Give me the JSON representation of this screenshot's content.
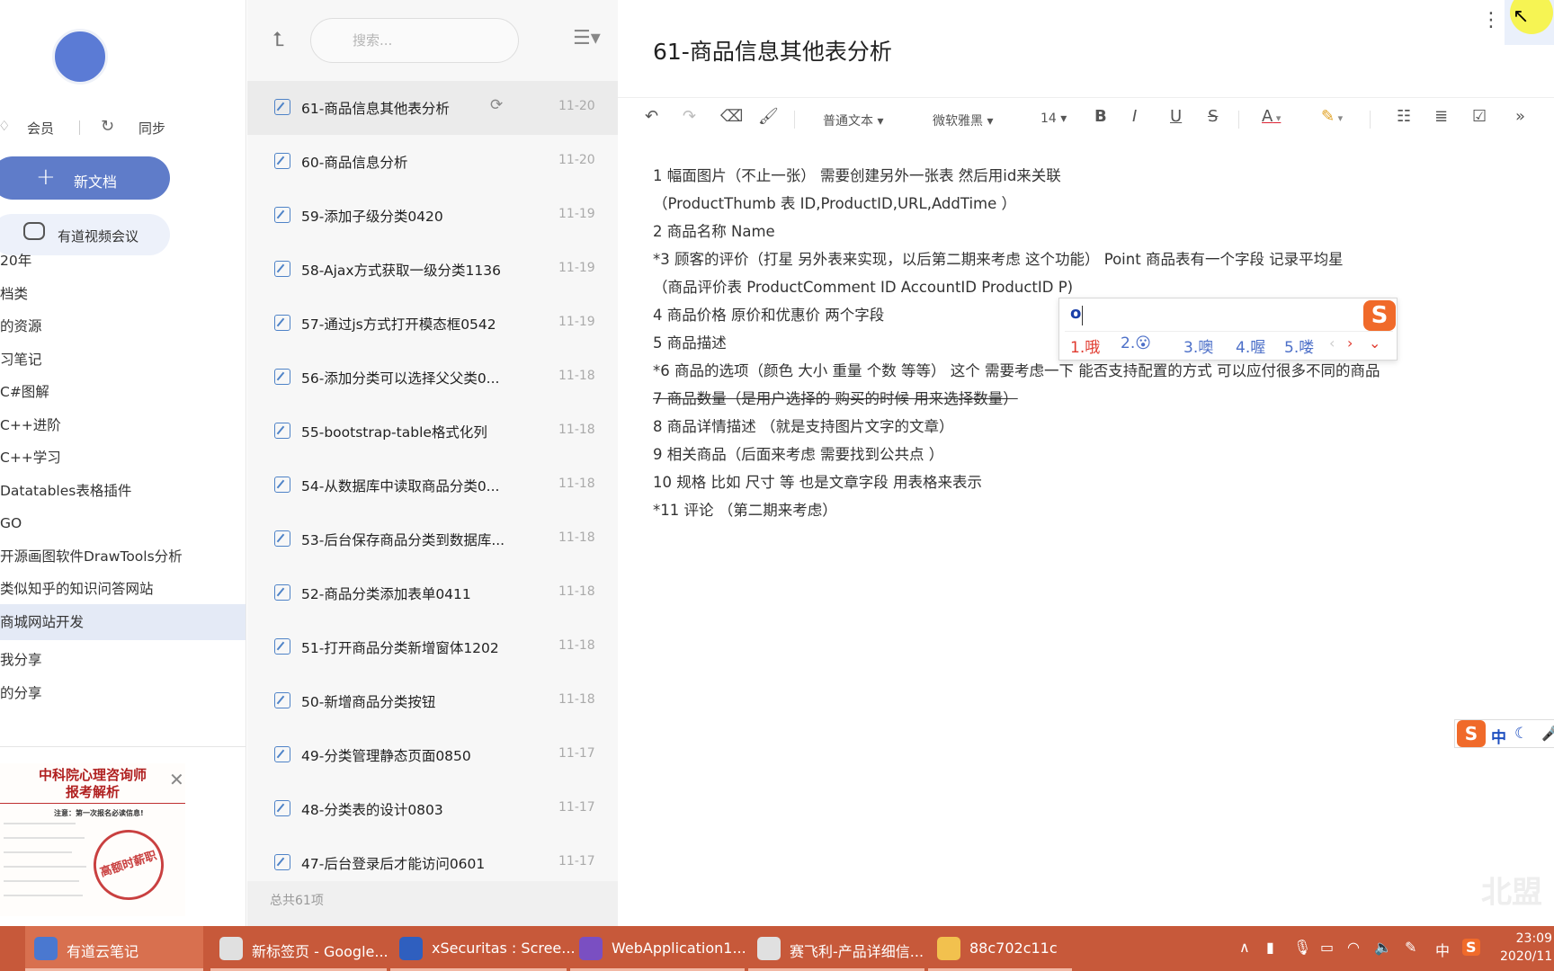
{
  "sidebar": {
    "vip_label": "会员",
    "sync_label": "同步",
    "new_doc_label": "新文档",
    "video_label": "有道视频会议",
    "tree": [
      {
        "label": "20年",
        "active": false
      },
      {
        "label": "档类",
        "active": false
      },
      {
        "label": "的资源",
        "active": false
      },
      {
        "label": "习笔记",
        "active": false
      },
      {
        "label": " C#图解",
        "active": false
      },
      {
        "label": " C++进阶",
        "active": false
      },
      {
        "label": " C++学习",
        "active": false
      },
      {
        "label": " Datatables表格插件",
        "active": false
      },
      {
        "label": " GO",
        "active": false
      },
      {
        "label": " 开源画图软件DrawTools分析",
        "active": false
      },
      {
        "label": " 类似知乎的知识问答网站",
        "active": false
      },
      {
        "label": " 商城网站开发",
        "active": true
      },
      {
        "label": "我分享",
        "active": false
      },
      {
        "label": "的分享",
        "active": false
      }
    ],
    "ad": {
      "title_line1": "中科院心理咨询师",
      "title_line2": "报考解析",
      "note": "注意：第一次报名必读信息!",
      "stamp": "高额时薪职位"
    }
  },
  "list": {
    "search_placeholder": "搜索...",
    "items": [
      {
        "title": "61-商品信息其他表分析",
        "date": "11-20",
        "active": true
      },
      {
        "title": "60-商品信息分析",
        "date": "11-20",
        "active": false
      },
      {
        "title": "59-添加子级分类0420",
        "date": "11-19",
        "active": false
      },
      {
        "title": "58-Ajax方式获取一级分类1136",
        "date": "11-19",
        "active": false
      },
      {
        "title": "57-通过js方式打开模态框0542",
        "date": "11-19",
        "active": false
      },
      {
        "title": "56-添加分类可以选择父父类0...",
        "date": "11-18",
        "active": false
      },
      {
        "title": "55-bootstrap-table格式化列",
        "date": "11-18",
        "active": false
      },
      {
        "title": "54-从数据库中读取商品分类0...",
        "date": "11-18",
        "active": false
      },
      {
        "title": "53-后台保存商品分类到数据库...",
        "date": "11-18",
        "active": false
      },
      {
        "title": "52-商品分类添加表单0411",
        "date": "11-18",
        "active": false
      },
      {
        "title": "51-打开商品分类新增窗体1202",
        "date": "11-18",
        "active": false
      },
      {
        "title": "50-新增商品分类按钮",
        "date": "11-18",
        "active": false
      },
      {
        "title": "49-分类管理静态页面0850",
        "date": "11-17",
        "active": false
      },
      {
        "title": "48-分类表的设计0803",
        "date": "11-17",
        "active": false
      },
      {
        "title": "47-后台登录后才能访问0601",
        "date": "11-17",
        "active": false
      }
    ],
    "footer": "总共61项"
  },
  "editor": {
    "title": "61-商品信息其他表分析",
    "toolbar": {
      "style": "普通文本",
      "font": "微软雅黑",
      "size": "14",
      "bold": "B",
      "italic": "I",
      "underline": "U",
      "strike": "S",
      "font_color": "A"
    },
    "lines": [
      {
        "text": "1 幅面图片（不止一张） 需要创建另外一张表 然后用id来关联",
        "strike": false
      },
      {
        "text": "（ProductThumb 表 ID,ProductID,URL,AddTime ）",
        "strike": false
      },
      {
        "text": "2 商品名称  Name",
        "strike": false
      },
      {
        "text": "*3 顾客的评价（打星 另外表来实现，以后第二期来考虑 这个功能）  Point  商品表有一个字段 记录平均星",
        "strike": false
      },
      {
        "text": "（商品评价表 ProductComment ID AccountID ProductID P)",
        "strike": false
      },
      {
        "text": "4 商品价格 原价和优惠价  两个字段",
        "strike": false
      },
      {
        "text": "5 商品描述",
        "strike": false
      },
      {
        "text": "*6 商品的选项（颜色 大小 重量 个数 等等） 这个 需要考虑一下 能否支持配置的方式  可以应付很多不同的商品",
        "strike": false
      },
      {
        "text": "7 商品数量（是用户选择的 购买的时候 用来选择数量）",
        "strike": true
      },
      {
        "text": "8 商品详情描述 （就是支持图片文字的文章）",
        "strike": false
      },
      {
        "text": "9 相关商品（后面来考虑 需要找到公共点 ）",
        "strike": false
      },
      {
        "text": "10 规格 比如 尺寸 等 也是文章字段 用表格来表示",
        "strike": false
      },
      {
        "text": "*11 评论 （第二期来考虑）",
        "strike": false
      }
    ],
    "ime": {
      "input": "o",
      "candidates": [
        "1.哦",
        "2.😮",
        "3.噢",
        "4.喔",
        "5.喽"
      ],
      "bar_mode": "中"
    },
    "watermark": "北盟"
  },
  "taskbar": {
    "tasks": [
      {
        "label": "有道云笔记",
        "color": "#4a78d0",
        "active": true
      },
      {
        "label": "新标签页 - Google...",
        "color": "#e0e0e0",
        "active": false
      },
      {
        "label": "xSecuritas : Scree...",
        "color": "#2f5fbf",
        "active": false
      },
      {
        "label": "WebApplication1...",
        "color": "#7a4fc2",
        "active": false
      },
      {
        "label": "赛飞利-产品详细信...",
        "color": "#e0e0e0",
        "active": false
      },
      {
        "label": "88c702c11c",
        "color": "#f2c14e",
        "active": false
      }
    ],
    "ime_indicator": "中",
    "time": "23:09",
    "date": "2020/11"
  },
  "colors": {
    "accent": "#5f7cc9",
    "taskbar": "#c7593a",
    "active_tree": "#e4eaf6",
    "ime_orange": "#f06a2a"
  }
}
